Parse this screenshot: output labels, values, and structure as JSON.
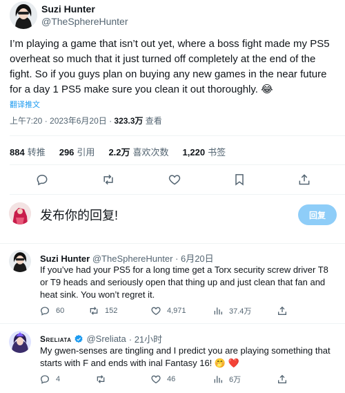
{
  "main_tweet": {
    "author_name": "Suzi Hunter",
    "author_handle": "@TheSphereHunter",
    "text": "I’m playing a game that isn’t out yet, where a boss fight made my PS5 overheat so much that it just turned off completely at the end of the fight. So if you guys plan on buying any new games in the near future for a day 1 PS5 make sure you clean it out thoroughly. 😂",
    "translate": "翻译推文",
    "time": "上午7:20 · 2023年6月20日 · ",
    "views_value": "323.3万",
    "views_label": " 查看",
    "stats": {
      "retweets": "884",
      "retweets_label": "转推",
      "quotes": "296",
      "quotes_label": "引用",
      "likes": "2.2万",
      "likes_label": "喜欢次数",
      "bookmarks": "1,220",
      "bookmarks_label": "书签"
    }
  },
  "reply_composer": {
    "placeholder": "发布你的回复!",
    "button": "回复"
  },
  "replies": [
    {
      "author_name": "Suzi Hunter",
      "author_handle": "@TheSphereHunter",
      "date": "· 6月20日",
      "text": "If you’ve had your PS5 for a long time get a Torx security screw driver T8 or T9 heads and seriously open that thing up and just clean that fan and heat sink. You won’t regret it.",
      "replies": "60",
      "retweets": "",
      "likes": "152",
      "views": "4,971",
      "bookmarks": "37.4万"
    },
    {
      "author_name": "Sreliata",
      "author_handle": "@Sreliata",
      "date": "· 21小时",
      "text": "My gwen-senses are tingling and I predict you are playing something that starts with F and ends with inal Fantasy 16! 🤭 ❤️",
      "replies": "4",
      "retweets": "",
      "likes": "46",
      "views": "6万",
      "bookmarks": ""
    }
  ],
  "colors": {
    "accent": "#1d9bf0",
    "verified": "#1d9bf0",
    "text": "#0f1419",
    "secondary": "#536471",
    "divider": "#eff3f4",
    "reply_button_disabled": "#8ecdf8"
  }
}
